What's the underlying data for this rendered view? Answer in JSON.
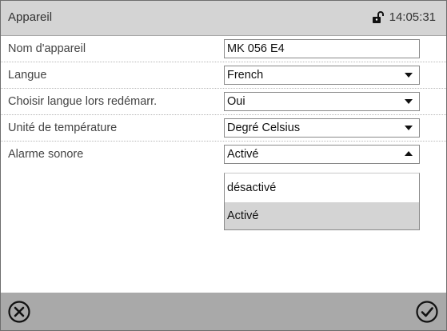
{
  "header": {
    "title": "Appareil",
    "time": "14:05:31"
  },
  "rows": [
    {
      "label": "Nom d'appareil",
      "value": "MK 056 E4"
    },
    {
      "label": "Langue",
      "value": "French"
    },
    {
      "label": "Choisir langue lors redémarr.",
      "value": "Oui"
    },
    {
      "label": "Unité de température",
      "value": "Degré Celsius"
    },
    {
      "label": "Alarme sonore",
      "value": "Activé"
    }
  ],
  "dropdown": {
    "options": [
      "désactivé",
      "Activé"
    ],
    "selected": "Activé"
  },
  "footer": {
    "cancel_icon": "circle-x-icon",
    "confirm_icon": "circle-check-icon"
  },
  "colors": {
    "header": "#d4d4d4",
    "footer": "#a9a9a9",
    "selected_option": "#d4d4d4"
  }
}
